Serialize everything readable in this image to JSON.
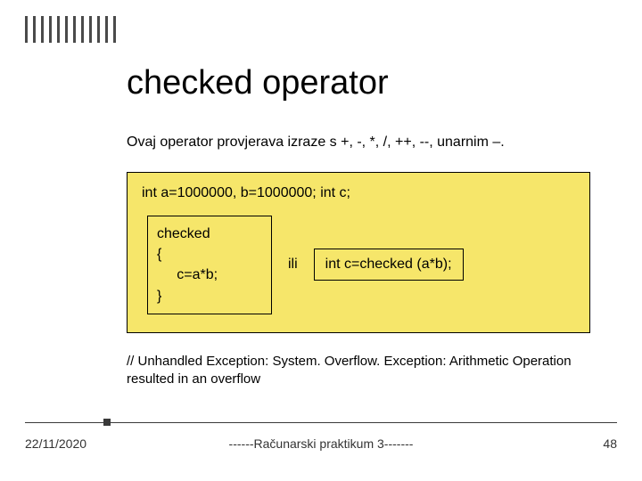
{
  "title": "checked operator",
  "intro": "Ovaj operator provjerava izraze s +, -, *, /, ++, --, unarnim –.",
  "codebox": {
    "declaration": "int a=1000000, b=1000000; int c;",
    "left_block": "checked\n{\n     c=a*b;\n}",
    "connector": "ili",
    "right_block": "int c=checked (a*b);"
  },
  "comment": "// Unhandled Exception: System. Overflow. Exception: Arithmetic Operation resulted in an overflow",
  "footer": {
    "date": "22/11/2020",
    "center": "------Računarski praktikum 3-------",
    "page": "48"
  }
}
